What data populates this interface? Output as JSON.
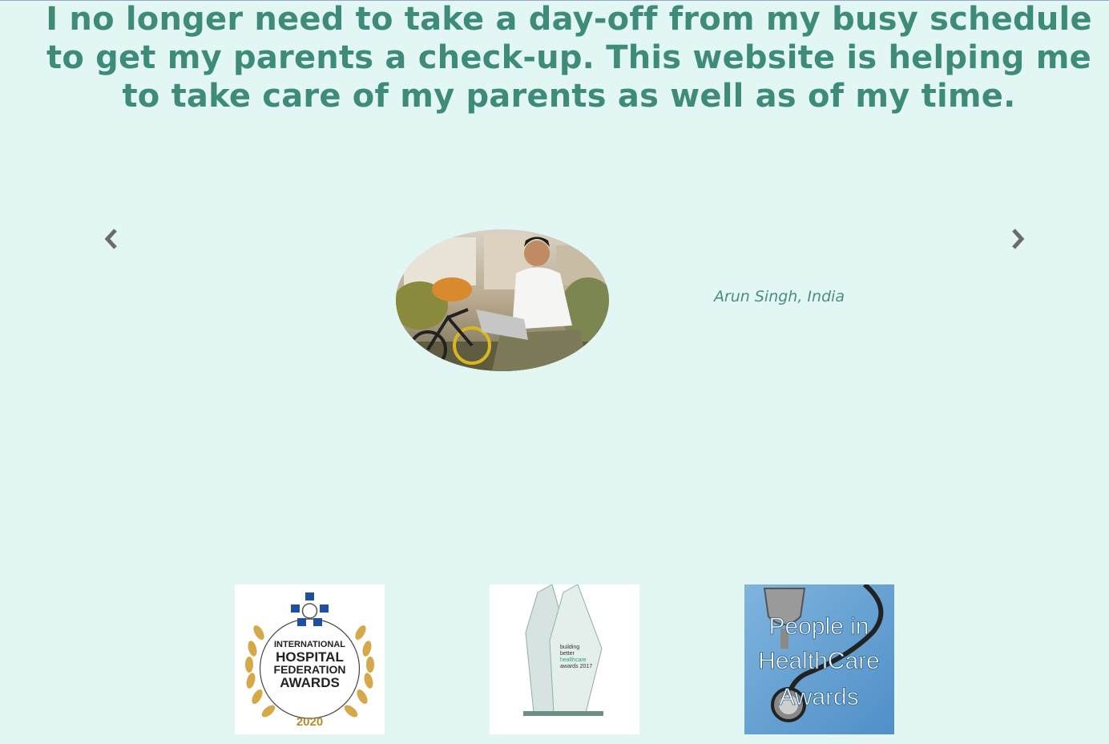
{
  "testimonial": {
    "quote": "I no longer need to take a day-off from my busy schedule to get my parents a check-up. This website is helping me to take care of my parents as well as of my time.",
    "author": "Arun Singh, India",
    "prev_icon": "chevron-left-icon",
    "next_icon": "chevron-right-icon"
  },
  "awards": [
    {
      "name": "ihf-award",
      "lines": [
        "INTERNATIONAL",
        "HOSPITAL",
        "FEDERATION",
        "AWARDS"
      ],
      "year": "2020"
    },
    {
      "name": "building-better-healthcare-award",
      "lines": [
        "building",
        "better",
        "healthcare",
        "awards 2017"
      ]
    },
    {
      "name": "people-in-healthcare-award",
      "lines": [
        "People in",
        "HealthCare",
        "Awards"
      ]
    }
  ],
  "colors": {
    "background": "#e2f7f3",
    "accent": "#3e8b79",
    "arrow": "#6b6b6b"
  }
}
